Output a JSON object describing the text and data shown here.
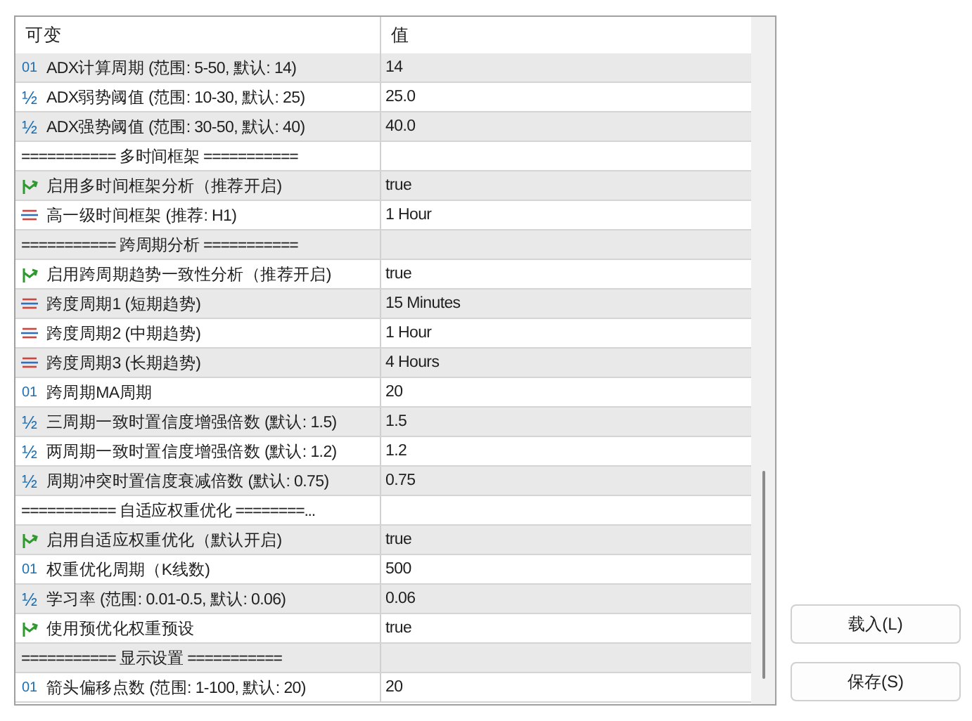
{
  "table": {
    "columns": [
      "可变",
      "值"
    ],
    "rows": [
      {
        "kind": "int",
        "icon": "01",
        "name": "ADX计算周期 (范围: 5-50, 默认: 14)",
        "value": "14"
      },
      {
        "kind": "double",
        "icon": "½",
        "name": "ADX弱势阈值 (范围: 10-30, 默认: 25)",
        "value": "25.0"
      },
      {
        "kind": "double",
        "icon": "½",
        "name": "ADX强势阈值 (范围: 30-50, 默认: 40)",
        "value": "40.0"
      },
      {
        "kind": "separator",
        "name": "=========== 多时间框架 ==========="
      },
      {
        "kind": "bool",
        "name": "启用多时间框架分析（推荐开启)",
        "value": "true"
      },
      {
        "kind": "enum",
        "name": "高一级时间框架 (推荐: H1)",
        "value": "1 Hour"
      },
      {
        "kind": "separator",
        "name": "=========== 跨周期分析 ==========="
      },
      {
        "kind": "bool",
        "name": "启用跨周期趋势一致性分析（推荐开启)",
        "value": "true"
      },
      {
        "kind": "enum",
        "name": "跨度周期1 (短期趋势)",
        "value": "15 Minutes"
      },
      {
        "kind": "enum",
        "name": "跨度周期2 (中期趋势)",
        "value": "1 Hour"
      },
      {
        "kind": "enum",
        "name": "跨度周期3 (长期趋势)",
        "value": "4 Hours"
      },
      {
        "kind": "int",
        "icon": "01",
        "name": "跨周期MA周期",
        "value": "20"
      },
      {
        "kind": "double",
        "icon": "½",
        "name": "三周期一致时置信度增强倍数 (默认: 1.5)",
        "value": "1.5"
      },
      {
        "kind": "double",
        "icon": "½",
        "name": "两周期一致时置信度增强倍数 (默认: 1.2)",
        "value": "1.2"
      },
      {
        "kind": "double",
        "icon": "½",
        "name": "周期冲突时置信度衰减倍数 (默认: 0.75)",
        "value": "0.75"
      },
      {
        "kind": "separator",
        "name": "=========== 自适应权重优化 ========..."
      },
      {
        "kind": "bool",
        "name": "启用自适应权重优化（默认开启)",
        "value": "true"
      },
      {
        "kind": "int",
        "icon": "01",
        "name": "权重优化周期（K线数)",
        "value": "500"
      },
      {
        "kind": "double",
        "icon": "½",
        "name": "学习率 (范围: 0.01-0.5, 默认: 0.06)",
        "value": "0.06"
      },
      {
        "kind": "bool",
        "name": "使用预优化权重预设",
        "value": "true"
      },
      {
        "kind": "separator",
        "name": "=========== 显示设置 ==========="
      },
      {
        "kind": "int",
        "icon": "01",
        "name": "箭头偏移点数 (范围: 1-100, 默认: 20)",
        "value": "20"
      }
    ]
  },
  "buttons": [
    "载入(L)",
    "保存(S)"
  ]
}
